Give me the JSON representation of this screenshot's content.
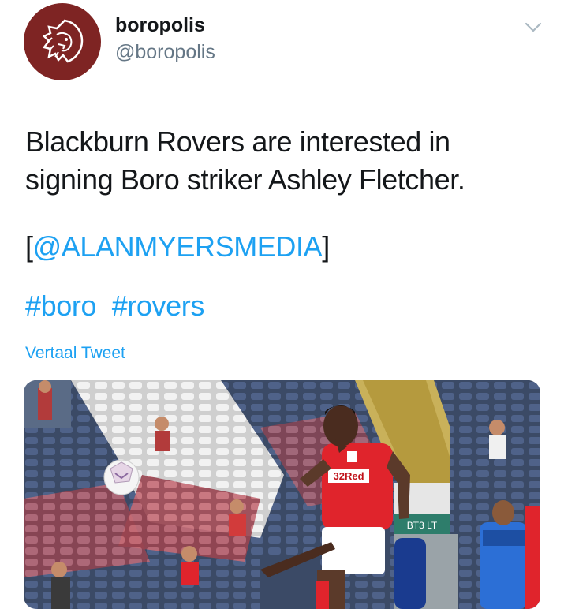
{
  "author": {
    "name": "boropolis",
    "handle": "@boropolis",
    "avatar_icon": "lion-head-icon",
    "avatar_color": "#7e2423"
  },
  "tweet": {
    "text": "Blackburn Rovers are interested in signing Boro striker Ashley Fletcher.",
    "mention_open": "[",
    "mention": "@ALANMYERSMEDIA",
    "mention_close": "]",
    "hashtags": [
      "#boro",
      "#rovers"
    ],
    "translate_label": "Vertaal Tweet",
    "link_color": "#1da1f2"
  },
  "media": {
    "shirt_sponsor": "32Red",
    "stand_sign": "BT3 LT"
  },
  "icons": {
    "menu": "chevron-down-icon"
  }
}
